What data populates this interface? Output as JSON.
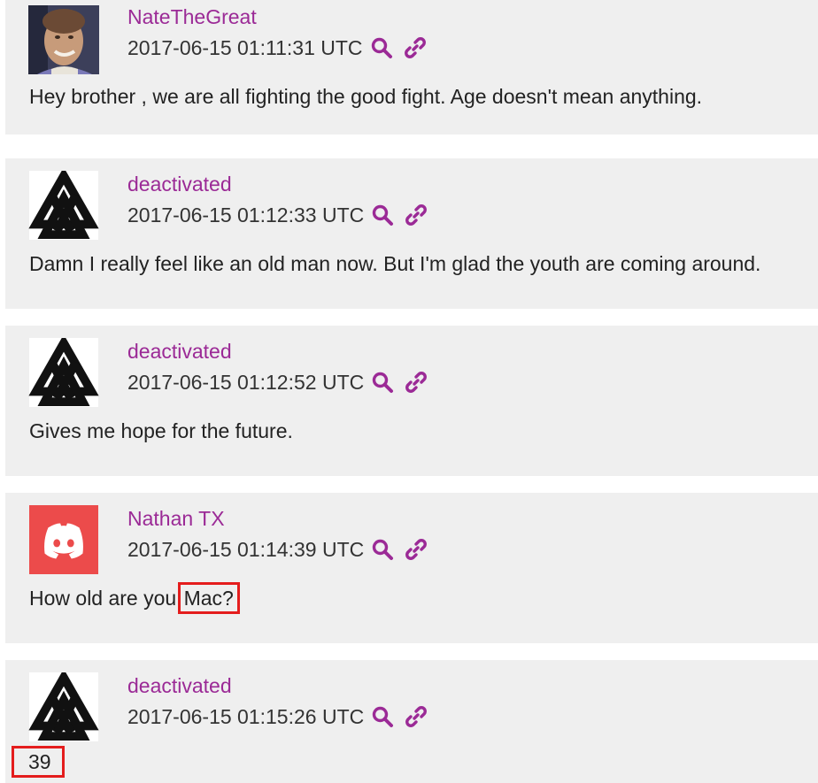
{
  "messages": [
    {
      "username": "NateTheGreat",
      "timestamp": "2017-06-15 01:11:31 UTC",
      "avatar": "person-photo",
      "text": "Hey brother , we are all fighting the good fight. Age doesn't mean anything.",
      "highlight": ""
    },
    {
      "username": "deactivated",
      "timestamp": "2017-06-15 01:12:33 UTC",
      "avatar": "valknut-symbol",
      "text": "Damn I really feel like an old man now. But I'm glad the youth are coming around.",
      "highlight": ""
    },
    {
      "username": "deactivated",
      "timestamp": "2017-06-15 01:12:52 UTC",
      "avatar": "valknut-symbol",
      "text": "Gives me hope for the future.",
      "highlight": ""
    },
    {
      "username": "Nathan TX",
      "timestamp": "2017-06-15 01:14:39 UTC",
      "avatar": "discord-logo",
      "text": "How old are you ",
      "highlight": "Mac?"
    },
    {
      "username": "deactivated",
      "timestamp": "2017-06-15 01:15:26 UTC",
      "avatar": "valknut-symbol",
      "text": "",
      "highlight": "39"
    }
  ],
  "icons": {
    "search": "search-icon",
    "link": "link-icon"
  },
  "colors": {
    "username": "#9b2a96",
    "card_background": "#efefef",
    "highlight_box": "#e41d1d",
    "discord_avatar": "#ec4b4b"
  }
}
